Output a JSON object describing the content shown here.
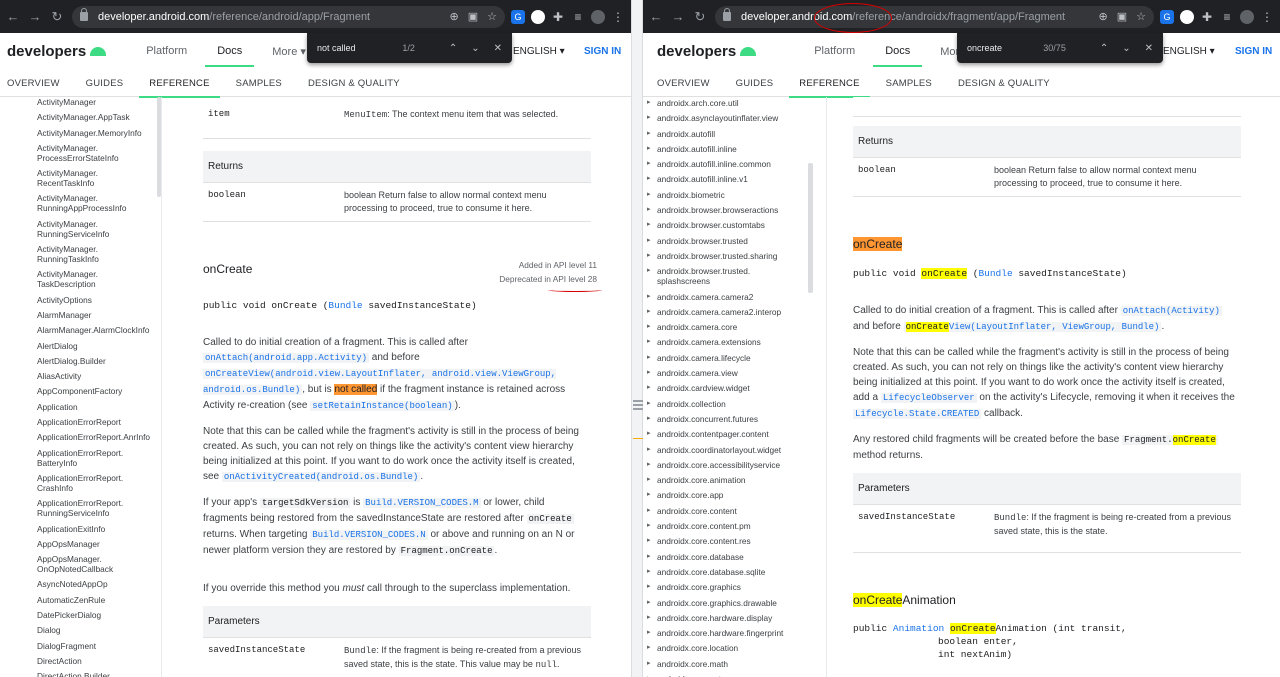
{
  "left": {
    "url_domain": "developer.android.com",
    "url_path": "/reference/android/app/Fragment",
    "site": {
      "logo": "developers",
      "nav": [
        "Platform",
        "Docs",
        "More ▾"
      ],
      "language": "ENGLISH ▾",
      "signin": "SIGN IN"
    },
    "subnav": [
      "OVERVIEW",
      "GUIDES",
      "REFERENCE",
      "SAMPLES",
      "DESIGN & QUALITY"
    ],
    "find": {
      "query": "not called",
      "count": "1/2"
    },
    "sidebar": [
      "ActivityManager",
      "ActivityManager.AppTask",
      "ActivityManager.MemoryInfo",
      "ActivityManager.\nProcessErrorStateInfo",
      "ActivityManager.\nRecentTaskInfo",
      "ActivityManager.\nRunningAppProcessInfo",
      "ActivityManager.\nRunningServiceInfo",
      "ActivityManager.\nRunningTaskInfo",
      "ActivityManager.\nTaskDescription",
      "ActivityOptions",
      "AlarmManager",
      "AlarmManager.AlarmClockInfo",
      "AlertDialog",
      "AlertDialog.Builder",
      "AliasActivity",
      "AppComponentFactory",
      "Application",
      "ApplicationErrorReport",
      "ApplicationErrorReport.AnrInfo",
      "ApplicationErrorReport.\nBatteryInfo",
      "ApplicationErrorReport.\nCrashInfo",
      "ApplicationErrorReport.\nRunningServiceInfo",
      "ApplicationExitInfo",
      "AppOpsManager",
      "AppOpsManager.\nOnOpNotedCallback",
      "AsyncNotedAppOp",
      "AutomaticZenRule",
      "DatePickerDialog",
      "Dialog",
      "DialogFragment",
      "DirectAction",
      "DirectAction.Builder"
    ],
    "item_row": {
      "name": "item",
      "type": "MenuItem",
      "desc": ": The context menu item that was selected."
    },
    "returns_header": "Returns",
    "returns_row": {
      "type": "boolean",
      "desc": "boolean Return false to allow normal context menu processing to proceed, true to consume it here."
    },
    "method": "onCreate",
    "added": "Added in API level 11",
    "deprecated": "Deprecated in API level 28",
    "signature": {
      "pre": "public void onCreate (",
      "type": "Bundle",
      "post": " savedInstanceState)"
    },
    "p1": {
      "a": "Called to do initial creation of a fragment. This is called after ",
      "c1": "onAttach(android.app.Activity)",
      "b": " and before ",
      "c2": "onCreateView(android.view.LayoutInflater, android.view.ViewGroup, android.os.Bundle)",
      "c": ", but is ",
      "hl": "not called",
      "d": " if the fragment instance is retained across Activity re-creation (see ",
      "c3": "setRetainInstance(boolean)",
      "e": ")."
    },
    "p2": {
      "a": "Note that this can be called while the fragment's activity is still in the process of being created. As such, you can not rely on things like the activity's content view hierarchy being initialized at this point. If you want to do work once the activity itself is created, see ",
      "c1": "onActivityCreated(android.os.Bundle)",
      "b": "."
    },
    "p3": {
      "a": "If your app's ",
      "c1": "targetSdkVersion",
      "b": " is ",
      "c2": "Build.VERSION_CODES.M",
      "c": " or lower, child fragments being restored from the savedInstanceState are restored after ",
      "c3": "onCreate",
      "d": " returns. When targeting ",
      "c4": "Build.VERSION_CODES.N",
      "e": " or above and running on an N or newer platform version they are restored by ",
      "c5": "Fragment.onCreate",
      "f": "."
    },
    "p4": {
      "a": "If you override this method you ",
      "em": "must",
      "b": " call through to the superclass implementation."
    },
    "params_header": "Parameters",
    "param_row": {
      "name": "savedInstanceState",
      "type": "Bundle",
      "desc": ": If the fragment is being re-created from a previous saved state, this is the state. This value may be ",
      "null": "null",
      "end": "."
    }
  },
  "right": {
    "url_domain": "developer.android.com",
    "url_path": "/reference/androidx/fragment/app/Fragment",
    "site": {
      "logo": "developers",
      "nav": [
        "Platform",
        "Docs",
        "More ▾"
      ],
      "language": "ENGLISH ▾",
      "signin": "SIGN IN"
    },
    "subnav": [
      "OVERVIEW",
      "GUIDES",
      "REFERENCE",
      "SAMPLES",
      "DESIGN & QUALITY"
    ],
    "find": {
      "query": "oncreate",
      "count": "30/75"
    },
    "sidebar": [
      "androidx.arch.core.util",
      "androidx.asynclayoutinflater.view",
      "androidx.autofill",
      "androidx.autofill.inline",
      "androidx.autofill.inline.common",
      "androidx.autofill.inline.v1",
      "androidx.biometric",
      "androidx.browser.browseractions",
      "androidx.browser.customtabs",
      "androidx.browser.trusted",
      "androidx.browser.trusted.sharing",
      "androidx.browser.trusted.\nsplashscreens",
      "androidx.camera.camera2",
      "androidx.camera.camera2.interop",
      "androidx.camera.core",
      "androidx.camera.extensions",
      "androidx.camera.lifecycle",
      "androidx.camera.view",
      "androidx.cardview.widget",
      "androidx.collection",
      "androidx.concurrent.futures",
      "androidx.contentpager.content",
      "androidx.coordinatorlayout.widget",
      "androidx.core.accessibilityservice",
      "androidx.core.animation",
      "androidx.core.app",
      "androidx.core.content",
      "androidx.core.content.pm",
      "androidx.core.content.res",
      "androidx.core.database",
      "androidx.core.database.sqlite",
      "androidx.core.graphics",
      "androidx.core.graphics.drawable",
      "androidx.core.hardware.display",
      "androidx.core.hardware.fingerprint",
      "androidx.core.location",
      "androidx.core.math",
      "androidx.core.net"
    ],
    "returns_header": "Returns",
    "returns_row": {
      "type": "boolean",
      "desc": "boolean Return false to allow normal context menu processing to proceed, true to consume it here."
    },
    "method": "onCreate",
    "signature": {
      "pre": "public void ",
      "hl": "onCreate",
      "mid": " (",
      "type": "Bundle",
      "post": " savedInstanceState)"
    },
    "p1": {
      "a": "Called to do initial creation of a fragment. This is called after ",
      "c1": "onAttach(Activity)",
      "b": " and before ",
      "hl": "onCreate",
      "c2": "View(LayoutInflater, ViewGroup, Bundle)",
      "c": "."
    },
    "p2": {
      "a": "Note that this can be called while the fragment's activity is still in the process of being created. As such, you can not rely on things like the activity's content view hierarchy being initialized at this point. If you want to do work once the activity itself is created, add a ",
      "c1": "LifecycleObserver",
      "b": " on the activity's Lifecycle, removing it when it receives the ",
      "c2": "Lifecycle.State.CREATED",
      "c": " callback."
    },
    "p3": {
      "a": "Any restored child fragments will be created before the base ",
      "c1": "Fragment.",
      "hl": "onCreate",
      "b": " method returns."
    },
    "params_header": "Parameters",
    "param_row": {
      "name": "savedInstanceState",
      "type": "Bundle",
      "desc": ": If the fragment is being re-created from a previous saved state, this is the state."
    },
    "method2": {
      "hl": "onCreate",
      "rest": "Animation"
    },
    "sig2": {
      "pre": "public ",
      "type": "Animation",
      "sp": " ",
      "hl": "onCreate",
      "post": "Animation (int transit,",
      "l2": "boolean enter,",
      "l3": "int nextAnim)"
    }
  }
}
